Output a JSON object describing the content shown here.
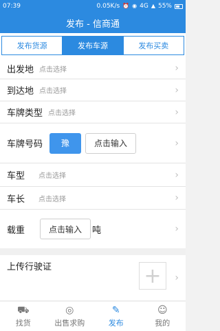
{
  "status": {
    "time": "07:39",
    "speed": "0.05K/s",
    "signal": "4G",
    "battery": "55%"
  },
  "title": "发布 - 信商通",
  "tabs": [
    {
      "label": "发布货源",
      "active": false
    },
    {
      "label": "发布车源",
      "active": true
    },
    {
      "label": "发布买卖",
      "active": false
    }
  ],
  "form": {
    "origin": {
      "label": "出发地",
      "hint": "点击选择"
    },
    "destination": {
      "label": "到达地",
      "hint": "点击选择"
    },
    "plate_type": {
      "label": "车牌类型",
      "hint": "点击选择"
    },
    "plate_number": {
      "label": "车牌号码",
      "prefix": "豫",
      "input": "点击输入"
    },
    "vehicle_type": {
      "label": "车型",
      "hint": "点击选择"
    },
    "vehicle_length": {
      "label": "车长",
      "hint": "点击选择"
    },
    "load": {
      "label": "载重",
      "input": "点击输入",
      "unit": "吨"
    },
    "license": {
      "label": "上传行驶证"
    }
  },
  "nav": [
    {
      "label": "找货",
      "icon": "truck-icon",
      "active": false
    },
    {
      "label": "出售求购",
      "icon": "coins-icon",
      "active": false
    },
    {
      "label": "发布",
      "icon": "edit-icon",
      "active": true
    },
    {
      "label": "我的",
      "icon": "person-icon",
      "active": false
    }
  ],
  "colors": {
    "primary": "#2c8ae0",
    "button": "#3f95ec"
  }
}
